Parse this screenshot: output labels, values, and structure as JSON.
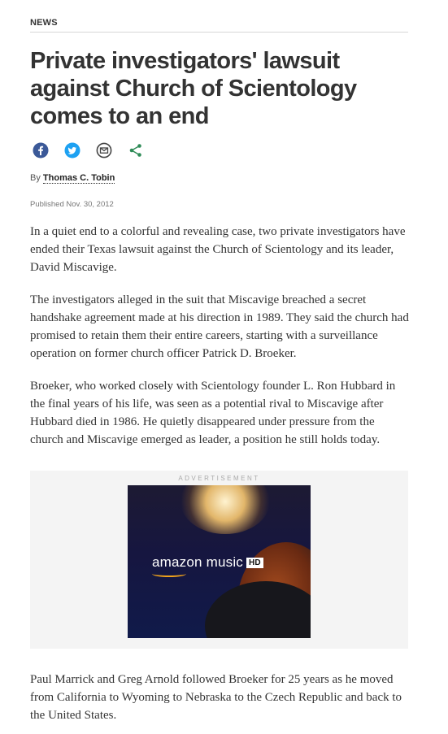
{
  "section": "NEWS",
  "headline": "Private investigators' lawsuit against Church of Scientology comes to an end",
  "share": {
    "icons": [
      "facebook-icon",
      "twitter-icon",
      "email-icon",
      "share-icon"
    ],
    "colors": {
      "facebook": "#3b5998",
      "twitter": "#1da1f2",
      "email": "#444444",
      "share": "#2e8b57"
    }
  },
  "byline": {
    "prefix": "By",
    "author": "Thomas C. Tobin"
  },
  "published": "Published Nov. 30, 2012",
  "paragraphs": [
    "In a quiet end to a colorful and revealing case, two private investigators have ended their Texas lawsuit against the Church of Scientology and its leader, David Miscavige.",
    "The investigators alleged in the suit that Miscavige breached a secret handshake agreement made at his direction in 1989. They said the church had promised to retain them their entire careers, starting with a surveillance operation on former church officer Patrick D. Broeker.",
    "Broeker, who worked closely with Scientology founder L. Ron Hubbard in the final years of his life, was seen as a potential rival to Miscavige after Hubbard died in 1986. He quietly disappeared under pressure from the church and Miscavige emerged as leader, a position he still holds today.",
    "Paul Marrick and Greg Arnold followed Broeker for 25 years as he moved from California to Wyoming to Nebraska to the Czech Republic and back to the United States."
  ],
  "ad": {
    "label": "ADVERTISEMENT",
    "brand": "amazon music",
    "badge": "HD"
  }
}
